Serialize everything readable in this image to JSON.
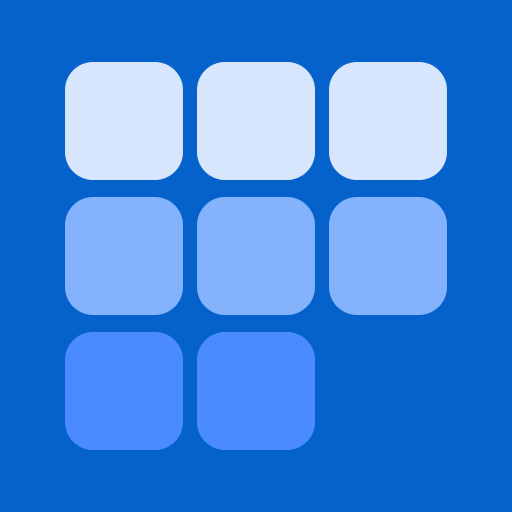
{
  "icon": {
    "name": "tile-grid-app-icon",
    "background_color": "#0562CB",
    "rows": [
      {
        "tile_count": 3,
        "color": "#D8E6FD"
      },
      {
        "tile_count": 3,
        "color": "#85B2FD"
      },
      {
        "tile_count": 2,
        "color": "#4A8CFF"
      }
    ]
  }
}
